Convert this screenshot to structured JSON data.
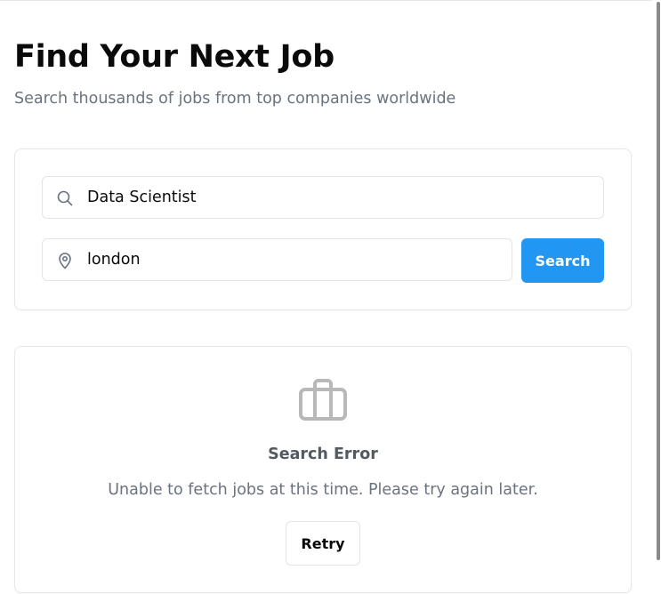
{
  "header": {
    "title": "Find Your Next Job",
    "subtitle": "Search thousands of jobs from top companies worldwide"
  },
  "search": {
    "keyword_value": "Data Scientist",
    "location_value": "london",
    "button_label": "Search",
    "keyword_icon": "search-icon",
    "location_icon": "map-pin-icon"
  },
  "error": {
    "icon": "briefcase-icon",
    "title": "Search Error",
    "message": "Unable to fetch jobs at this time. Please try again later.",
    "retry_label": "Retry"
  },
  "colors": {
    "accent": "#2196f3",
    "muted_text": "#6b7280",
    "border": "#e5e7eb",
    "icon_gray": "#b8b8b8"
  }
}
